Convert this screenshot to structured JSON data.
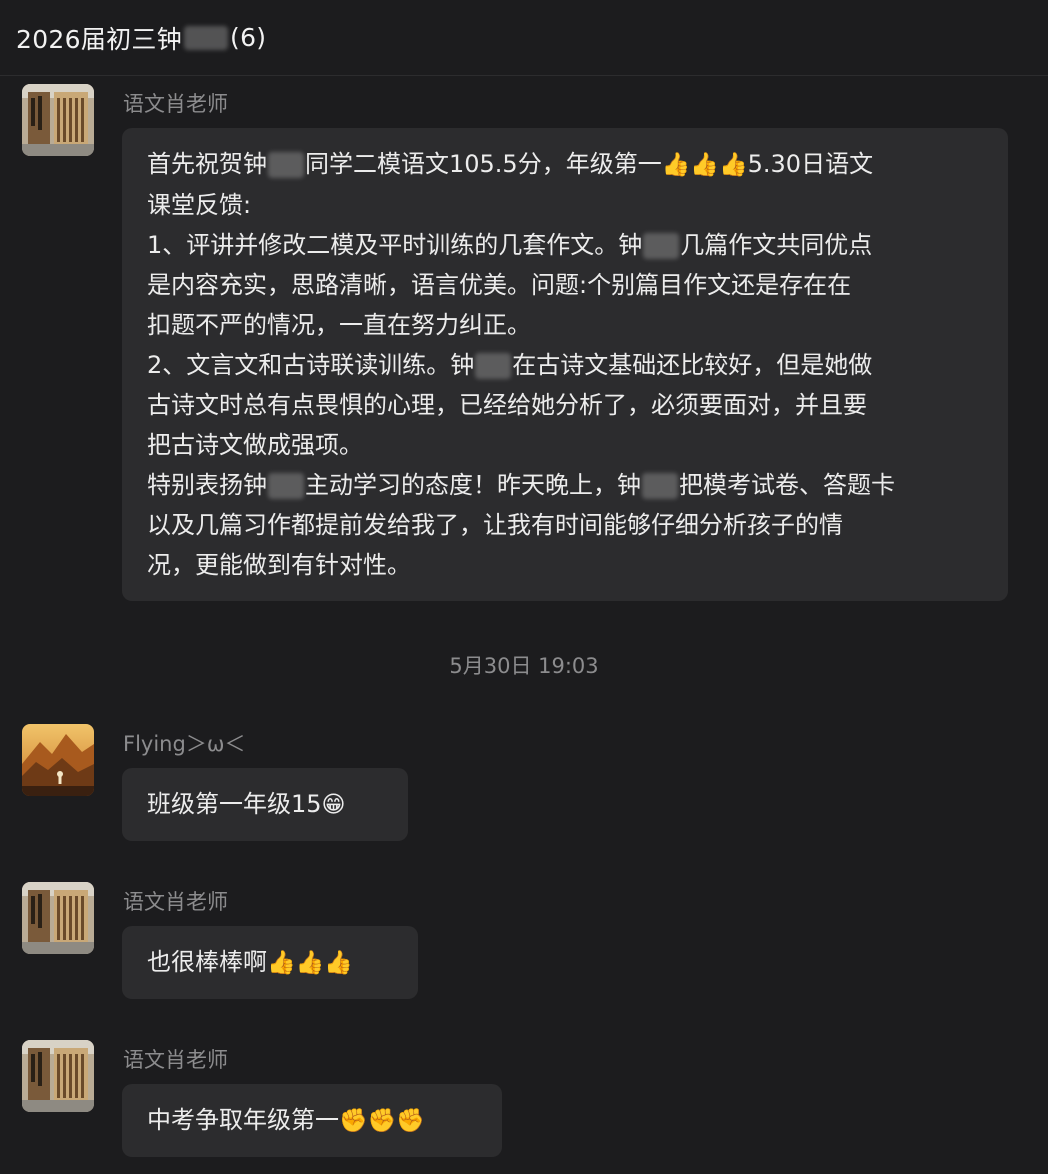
{
  "header": {
    "title_prefix": "2026届初三钟",
    "title_suffix": "(6)"
  },
  "messages": [
    {
      "sender": "语文肖老师",
      "lines": [
        [
          "首先祝贺钟",
          "同学二模语文105.5分，年级第一",
          "👍👍👍",
          "5.30日语文"
        ],
        [
          "课堂反馈:"
        ],
        [
          "1、评讲并修改二模及平时训练的几套作文。钟",
          "几篇作文共同优点"
        ],
        [
          "是内容充实，思路清晰，语言优美。问题:个别篇目作文还是存在在"
        ],
        [
          "扣题不严的情况，一直在努力纠正。"
        ],
        [
          "2、文言文和古诗联读训练。钟",
          "在古诗文基础还比较好，但是她做"
        ],
        [
          "古诗文时总有点畏惧的心理，已经给她分析了，必须要面对，并且要"
        ],
        [
          "把古诗文做成强项。"
        ],
        [
          "特别表扬钟",
          "主动学习的态度！昨天晚上，钟",
          "把模考试卷、答题卡"
        ],
        [
          "以及几篇习作都提前发给我了，让我有时间能够仔细分析孩子的情"
        ],
        [
          "况，更能做到有针对性。"
        ]
      ]
    },
    {
      "sender": "Flying＞ω＜",
      "text": "班级第一年级15",
      "emoji": "😁"
    },
    {
      "sender": "语文肖老师",
      "text": "也很棒棒啊",
      "emoji": "👍👍👍"
    },
    {
      "sender": "语文肖老师",
      "text": "中考争取年级第一",
      "emoji": "✊✊✊"
    }
  ],
  "timestamp": "5月30日 19:03",
  "colors": {
    "background": "#1c1c1e",
    "bubble": "#2c2c2e",
    "sender_text": "#8c8c8e",
    "message_text": "#ececec"
  }
}
